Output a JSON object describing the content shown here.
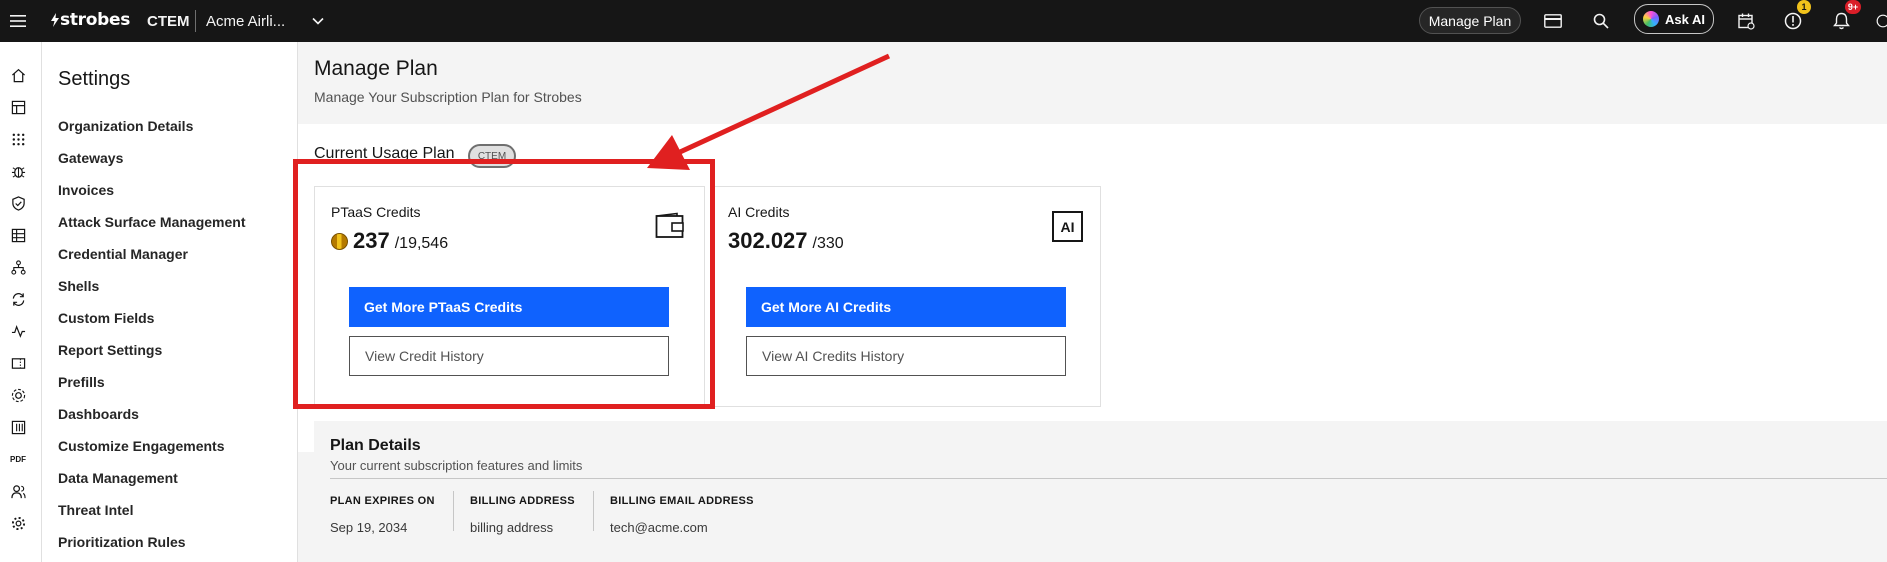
{
  "topbar": {
    "brand": "strobes",
    "product": "CTEM",
    "org": "Acme Airli...",
    "manage_plan": "Manage Plan",
    "ask_ai": "Ask AI",
    "alert_badge": "1",
    "notif_badge": "9+"
  },
  "sidebar": {
    "title": "Settings",
    "items": [
      "Organization Details",
      "Gateways",
      "Invoices",
      "Attack Surface Management",
      "Credential Manager",
      "Shells",
      "Custom Fields",
      "Report Settings",
      "Prefills",
      "Dashboards",
      "Customize Engagements",
      "Data Management",
      "Threat Intel",
      "Prioritization Rules"
    ]
  },
  "rail": {
    "pdf_label": "PDF"
  },
  "page": {
    "title": "Manage Plan",
    "subtitle": "Manage Your Subscription Plan for Strobes",
    "current_usage_label": "Current Usage Plan",
    "plan_tag": "CTEM"
  },
  "ptaas": {
    "title": "PTaaS Credits",
    "used": "237",
    "total": "/19,546",
    "primary_button": "Get More PTaaS Credits",
    "secondary_button": "View Credit History"
  },
  "ai": {
    "title": "AI Credits",
    "icon_text": "AI",
    "used": "302.027",
    "total": "/330",
    "primary_button": "Get More AI Credits",
    "secondary_button": "View AI Credits History"
  },
  "plan_details": {
    "title": "Plan Details",
    "subtitle": "Your current subscription features and limits",
    "fields": [
      {
        "label": "PLAN EXPIRES ON",
        "value": "Sep 19, 2034"
      },
      {
        "label": "BILLING ADDRESS",
        "value": "billing address"
      },
      {
        "label": "BILLING EMAIL ADDRESS",
        "value": "tech@acme.com"
      }
    ]
  },
  "colors": {
    "primary": "#0f62fe",
    "annotation": "#e02020",
    "topbar": "#161616"
  }
}
